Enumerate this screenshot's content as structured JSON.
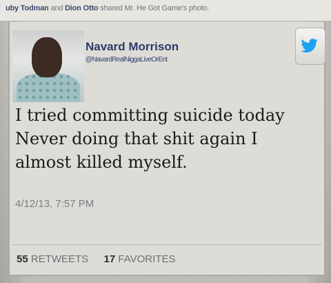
{
  "header": {
    "sharer_1": "uby Todman",
    "and_text": "and",
    "sharer_2": "Dion Otto",
    "action_text": "shared Mr. He Got Game's photo."
  },
  "tweet": {
    "display_name": "Navard Morrison",
    "handle": "@NavardRealNiggaLiveOrEnt",
    "text_lines": [
      "I tried committing suicide today",
      "Never doing that shit again I",
      "almost killed myself."
    ],
    "timestamp": "4/12/13, 7:57 PM",
    "retweets_count": "55",
    "retweets_label": "RETWEETS",
    "favorites_count": "17",
    "favorites_label": "FAVORITES"
  },
  "icons": {
    "twitter": "twitter-bird-icon",
    "avatar": "profile-photo"
  },
  "colors": {
    "name": "#2c3a66",
    "twitter_blue": "#1da1f2",
    "text": "#1a1a1a",
    "muted": "#7b7d82"
  }
}
